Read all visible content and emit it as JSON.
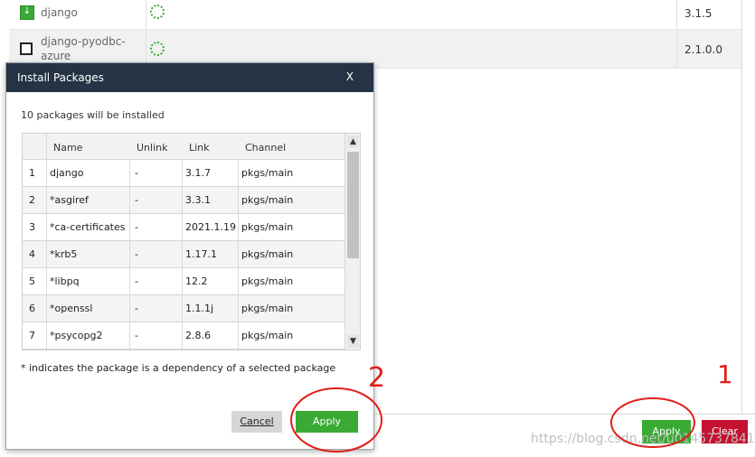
{
  "background_table": {
    "rows": [
      {
        "name": "django",
        "checked": true,
        "version": "3.1.5"
      },
      {
        "name_line1": "django-pyodbc-",
        "name_line2": "azure",
        "checked": false,
        "version": "2.1.0.0"
      }
    ]
  },
  "footer": {
    "apply_label": "Apply",
    "clear_label": "Clear",
    "watermark": "https://blog.csdn.net/u014573784189"
  },
  "dialog": {
    "title": "Install Packages",
    "close_label": "X",
    "message": "10 packages will be installed",
    "columns": [
      "Name",
      "Unlink",
      "Link",
      "Channel"
    ],
    "rows": [
      {
        "num": "1",
        "name": "django",
        "unlink": "-",
        "link": "3.1.7",
        "channel": "pkgs/main"
      },
      {
        "num": "2",
        "name": "*asgiref",
        "unlink": "-",
        "link": "3.3.1",
        "channel": "pkgs/main"
      },
      {
        "num": "3",
        "name": "*ca-certificates",
        "unlink": "-",
        "link": "2021.1.19",
        "channel": "pkgs/main"
      },
      {
        "num": "4",
        "name": "*krb5",
        "unlink": "-",
        "link": "1.17.1",
        "channel": "pkgs/main"
      },
      {
        "num": "5",
        "name": "*libpq",
        "unlink": "-",
        "link": "12.2",
        "channel": "pkgs/main"
      },
      {
        "num": "6",
        "name": "*openssl",
        "unlink": "-",
        "link": "1.1.1j",
        "channel": "pkgs/main"
      },
      {
        "num": "7",
        "name": "*psycopg2",
        "unlink": "-",
        "link": "2.8.6",
        "channel": "pkgs/main"
      }
    ],
    "note": "* indicates the package is a dependency of a selected package",
    "cancel_label": "Cancel",
    "apply_label": "Apply"
  },
  "annotations": {
    "label_1": "1",
    "label_2": "2",
    "color": "#e0201a"
  },
  "colors": {
    "header_bg": "#243444",
    "apply_green": "#3aaa35",
    "clear_red": "#c41230"
  }
}
